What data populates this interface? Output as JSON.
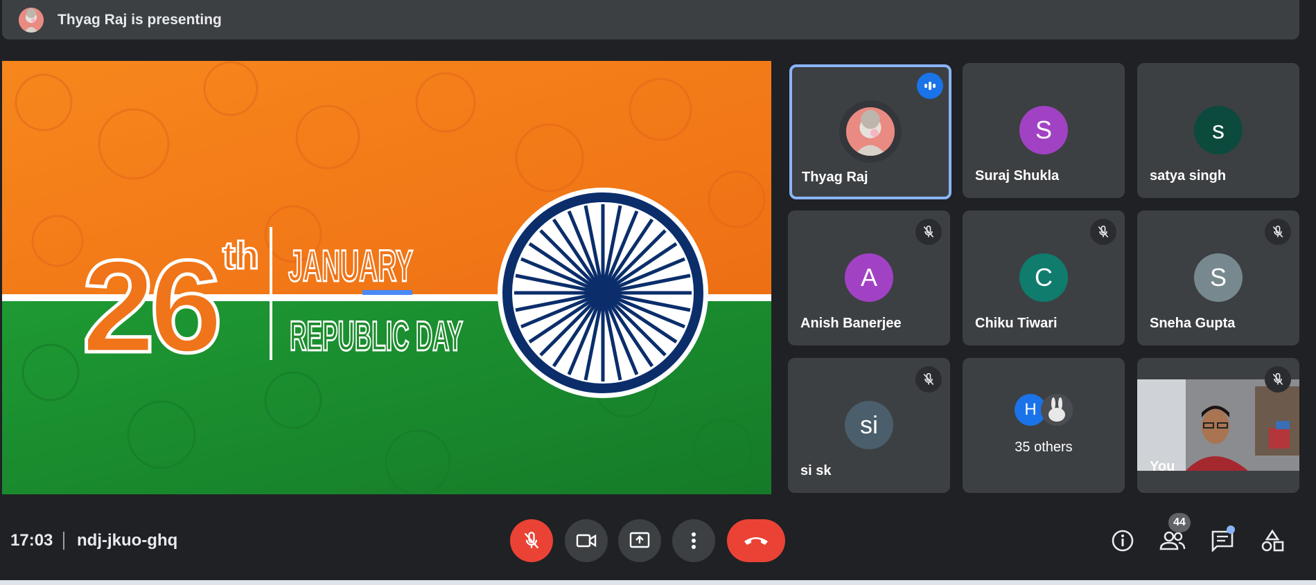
{
  "presenting_bar": {
    "text": "Thyag Raj is presenting"
  },
  "slide": {
    "number": "26",
    "suffix": "th",
    "month": "JANUARY",
    "occasion": "REPUBLIC DAY"
  },
  "participants": [
    {
      "name": "Thyag Raj",
      "initial": "",
      "color": "#e98b83",
      "state": "speaking",
      "active": true
    },
    {
      "name": "Suraj Shukla",
      "initial": "S",
      "color": "#a142c4",
      "state": "none",
      "active": false
    },
    {
      "name": "satya singh",
      "initial": "s",
      "color": "#0b4a3d",
      "state": "none",
      "active": false
    },
    {
      "name": "Anish Banerjee",
      "initial": "A",
      "color": "#a142c4",
      "state": "muted",
      "active": false
    },
    {
      "name": "Chiku Tiwari",
      "initial": "C",
      "color": "#0f7c6e",
      "state": "muted",
      "active": false
    },
    {
      "name": "Sneha Gupta",
      "initial": "S",
      "color": "#77898f",
      "state": "muted",
      "active": false
    },
    {
      "name": "si sk",
      "initial": "si",
      "color": "#4a5f6b",
      "state": "muted",
      "active": false
    }
  ],
  "others_tile": {
    "label": "35 others",
    "avatar_initial": "H",
    "avatar_color": "#1a73e8"
  },
  "self_tile": {
    "name": "You",
    "state": "muted"
  },
  "bottom_bar": {
    "time": "17:03",
    "meeting_code": "ndj-jkuo-ghq",
    "participant_count": "44"
  },
  "icons": {
    "mic": "mic-off-icon",
    "camera": "videocam-icon",
    "present": "present-screen-icon",
    "more": "more-vert-icon",
    "leave": "call-end-icon",
    "info": "info-icon",
    "people": "people-icon",
    "chat": "chat-icon",
    "activities": "activities-icon"
  },
  "colors": {
    "background": "#202124",
    "surface": "#3c4043",
    "accent_blue": "#8ab4f8",
    "danger_red": "#ea4335",
    "saffron": "#f27e1e",
    "india_green": "#1f8a2e",
    "chakra_navy": "#0b2e6b"
  }
}
